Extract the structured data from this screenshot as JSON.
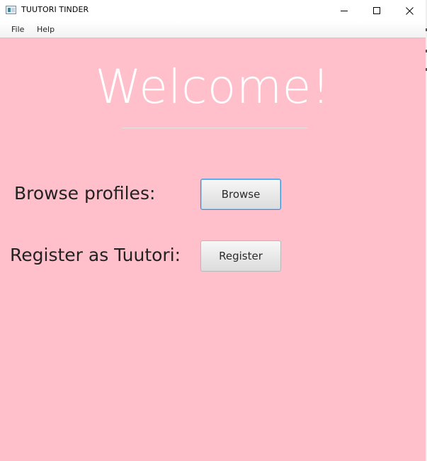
{
  "window": {
    "title": "TUUTORI TINDER",
    "icon": "app-window-icon",
    "controls": [
      "minimize-icon",
      "maximize-icon",
      "close-icon"
    ]
  },
  "menu": {
    "file": "File",
    "help": "Help"
  },
  "main": {
    "heading": "Welcome!",
    "browse_label": "Browse profiles:",
    "browse_button": "Browse",
    "register_label": "Register as Tuutori:",
    "register_button": "Register"
  },
  "colors": {
    "background": "#ffc0cb",
    "heading": "#ffffff",
    "focus_border": "#3d8fd1"
  }
}
